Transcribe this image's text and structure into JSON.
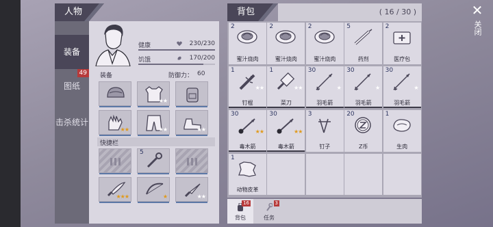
{
  "character": {
    "title": "人物",
    "tabs": [
      {
        "label": "装备"
      },
      {
        "label": "图纸",
        "badge": "49"
      },
      {
        "label": "击杀统计"
      }
    ],
    "stats": {
      "health": {
        "label": "健康",
        "value": "230/230",
        "fraction": 1.0
      },
      "hunger": {
        "label": "饥饿",
        "value": "170/200",
        "fraction": 0.85
      }
    },
    "equipment_label": "装备",
    "defense_label": "防御力：",
    "defense_value": "60",
    "quickbar_label": "快捷栏",
    "equipment_slots": [
      {
        "icon": "helmet-icon",
        "stars": ""
      },
      {
        "icon": "armor-vest-icon",
        "stars": "★★",
        "star_color": "white"
      },
      {
        "icon": "backpack-icon",
        "stars": ""
      },
      {
        "icon": "gloves-icon",
        "stars": "★★",
        "star_color": "gold"
      },
      {
        "icon": "pants-icon",
        "stars": "★★",
        "star_color": "white"
      },
      {
        "icon": "boots-icon",
        "stars": "★★",
        "star_color": "white"
      }
    ],
    "quick_slots": [
      {
        "icon": "empty-slot-icon",
        "count": "",
        "stars": ""
      },
      {
        "icon": "wrench-icon",
        "count": "5",
        "stars": ""
      },
      {
        "icon": "empty-slot-icon",
        "count": "",
        "stars": ""
      },
      {
        "icon": "machete-icon",
        "count": "",
        "stars": "★★★",
        "star_color": "gold"
      },
      {
        "icon": "bow-icon",
        "count": "",
        "stars": "★",
        "star_color": "gold"
      },
      {
        "icon": "knife-icon",
        "count": "",
        "stars": "★★",
        "star_color": "white"
      }
    ]
  },
  "backpack": {
    "title": "背包",
    "count": "( 16 / 30 )",
    "items": [
      {
        "name": "蜜汁烧肉",
        "count": "2",
        "icon": "meat-dish-icon",
        "stars": ""
      },
      {
        "name": "蜜汁烧肉",
        "count": "2",
        "icon": "meat-dish-icon",
        "stars": ""
      },
      {
        "name": "蜜汁烧肉",
        "count": "2",
        "icon": "meat-dish-icon",
        "stars": ""
      },
      {
        "name": "药剂",
        "count": "5",
        "icon": "syringe-icon",
        "stars": ""
      },
      {
        "name": "医疗包",
        "count": "2",
        "icon": "medkit-icon",
        "stars": ""
      },
      {
        "name": "钉棍",
        "count": "1",
        "icon": "spiked-club-icon",
        "stars": "★★",
        "star_color": "white"
      },
      {
        "name": "菜刀",
        "count": "1",
        "icon": "cleaver-icon",
        "stars": "★★",
        "star_color": "white"
      },
      {
        "name": "羽毛箭",
        "count": "30",
        "icon": "arrow-icon",
        "stars": "★",
        "star_color": "white"
      },
      {
        "name": "羽毛箭",
        "count": "30",
        "icon": "arrow-icon",
        "stars": "★",
        "star_color": "white"
      },
      {
        "name": "羽毛箭",
        "count": "30",
        "icon": "arrow-icon",
        "stars": "★",
        "star_color": "white"
      },
      {
        "name": "毒木箭",
        "count": "30",
        "icon": "poison-arrow-icon",
        "stars": "★★",
        "star_color": "gold"
      },
      {
        "name": "毒木箭",
        "count": "30",
        "icon": "poison-arrow-icon",
        "stars": "★★",
        "star_color": "gold"
      },
      {
        "name": "钉子",
        "count": "3",
        "icon": "nails-icon",
        "stars": ""
      },
      {
        "name": "Z币",
        "count": "20",
        "icon": "coin-icon",
        "stars": ""
      },
      {
        "name": "生肉",
        "count": "1",
        "icon": "raw-meat-icon",
        "stars": ""
      },
      {
        "name": "动物皮革",
        "count": "1",
        "icon": "leather-icon",
        "stars": ""
      }
    ],
    "tabs": [
      {
        "label": "背包",
        "badge": "16"
      },
      {
        "label": "任务",
        "badge": "3"
      }
    ]
  },
  "close": {
    "label": "关闭"
  },
  "colors": {
    "header": "#4a4658",
    "badge": "#b73a3a",
    "gold_star": "#e09a1b"
  }
}
